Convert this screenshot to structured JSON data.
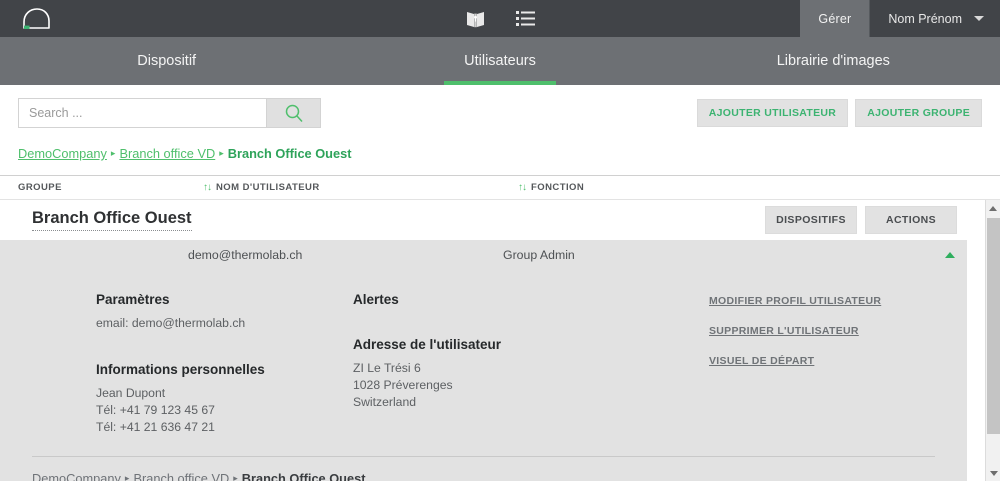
{
  "topbar": {
    "logo_name": "cloud-logo",
    "icons": [
      {
        "name": "map-book-icon",
        "label": "Map"
      },
      {
        "name": "list-icon",
        "label": "List"
      }
    ],
    "manage_tab": "Gérer",
    "user_name": "Nom Prénom"
  },
  "nav": {
    "tabs": [
      {
        "label": "Dispositif",
        "active": false
      },
      {
        "label": "Utilisateurs",
        "active": true
      },
      {
        "label": "Librairie d'images",
        "active": false
      }
    ]
  },
  "toolbar": {
    "search_placeholder": "Search ...",
    "search_value": "",
    "search_icon": "search-icon",
    "add_user_label": "AJOUTER UTILISATEUR",
    "add_group_label": "AJOUTER GROUPE"
  },
  "breadcrumb_top": {
    "items": [
      "DemoCompany",
      "Branch office VD"
    ],
    "current": "Branch Office Ouest",
    "separator": "▸"
  },
  "table": {
    "headers": {
      "group": "GROUPE",
      "username": "NOM D'UTILISATEUR",
      "function": "FONCTION",
      "sort_icon": "↑↓"
    },
    "group_row": {
      "title": "Branch Office Ouest",
      "devices_button": "DISPOSITIFS",
      "actions_button": "ACTIONS"
    },
    "user_row": {
      "username": "demo@thermolab.ch",
      "function": "Group Admin",
      "expand_icon": "caret-up"
    }
  },
  "detail": {
    "settings_heading": "Paramètres",
    "settings_email": "email: demo@thermolab.ch",
    "personal_heading": "Informations personnelles",
    "personal_lines": [
      "Jean Dupont",
      "Tél: +41 79 123 45 67",
      "Tél: +41 21 636 47 21"
    ],
    "alerts_heading": "Alertes",
    "address_heading": "Adresse de l'utilisateur",
    "address_lines": [
      "ZI Le Trési 6",
      "1028 Préverenges",
      "Switzerland"
    ],
    "links": [
      "MODIFIER PROFIL UTILISATEUR",
      "SUPPRIMER L'UTILISATEUR",
      "VISUEL DE DÉPART"
    ]
  },
  "breadcrumb_bottom": {
    "items": [
      "DemoCompany",
      "Branch office VD"
    ],
    "current": "Branch Office Ouest",
    "separator": "▸"
  },
  "colors": {
    "topbar_bg": "#414448",
    "navbar_bg": "#6d7074",
    "accent_green": "#4fbf6c",
    "panel_bg": "#e2e2e2"
  }
}
